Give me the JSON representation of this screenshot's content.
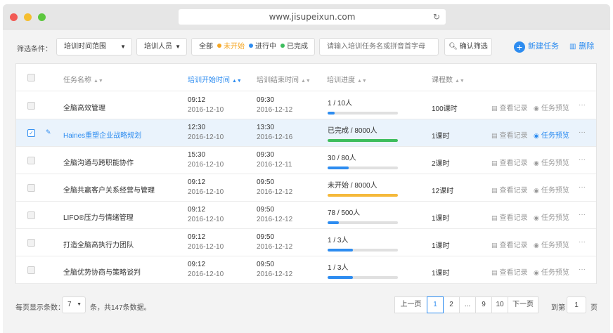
{
  "browser": {
    "url": "www.jisupeixun.com",
    "reload_icon": "reload-icon"
  },
  "filters": {
    "label": "筛选条件：",
    "time_range": "培训时间范围",
    "trainer": "培训人员",
    "status": {
      "all": "全部",
      "not_started": "未开始",
      "in_progress": "进行中",
      "done": "已完成"
    },
    "search_placeholder": "请输入培训任务名或拼音首字母",
    "confirm": "确认筛选",
    "new_task": "新建任务",
    "delete": "删除"
  },
  "colors": {
    "accent": "#2d8cf0",
    "not_started": "#f5a623",
    "in_progress": "#2d8cf0",
    "done": "#3dbd5d"
  },
  "table": {
    "headers": {
      "name": "任务名称",
      "start": "培训开始时间",
      "end": "培训结束时间",
      "progress": "培训进度",
      "courses": "课程数"
    },
    "action_view": "查看记录",
    "action_preview": "任务预览",
    "action_more": "···",
    "rows": [
      {
        "name": "全脑高效管理",
        "start_time": "09:12",
        "start_date": "2016-12-10",
        "end_time": "09:30",
        "end_date": "2016-12-12",
        "progress_text": "1 / 10人",
        "progress": 0.1,
        "bar_color": "#2d8cf0",
        "courses": "100课时",
        "selected": false
      },
      {
        "name": "Haines重塑企业战略规划",
        "start_time": "12:30",
        "start_date": "2016-12-10",
        "end_time": "13:30",
        "end_date": "2016-12-16",
        "progress_text": "已完成 / 8000人",
        "progress": 1.0,
        "bar_color": "#3dbd5d",
        "courses": "1课时",
        "selected": true
      },
      {
        "name": "全脑沟通与跨职能协作",
        "start_time": "15:30",
        "start_date": "2016-12-10",
        "end_time": "09:30",
        "end_date": "2016-12-11",
        "progress_text": "30 / 80人",
        "progress": 0.3,
        "bar_color": "#2d8cf0",
        "courses": "2课时",
        "selected": false
      },
      {
        "name": "全脑共赢客户关系经营与管理",
        "start_time": "09:12",
        "start_date": "2016-12-10",
        "end_time": "09:50",
        "end_date": "2016-12-12",
        "progress_text": "未开始 / 8000人",
        "progress": 1.0,
        "bar_color": "#f5b93b",
        "courses": "12课时",
        "selected": false
      },
      {
        "name": "LIFO®压力与情绪管理",
        "start_time": "09:12",
        "start_date": "2016-12-10",
        "end_time": "09:50",
        "end_date": "2016-12-12",
        "progress_text": "78 / 500人",
        "progress": 0.16,
        "bar_color": "#2d8cf0",
        "courses": "1课时",
        "selected": false
      },
      {
        "name": "打造全脑高执行力团队",
        "start_time": "09:12",
        "start_date": "2016-12-10",
        "end_time": "09:50",
        "end_date": "2016-12-12",
        "progress_text": "1 / 3人",
        "progress": 0.36,
        "bar_color": "#2d8cf0",
        "courses": "1课时",
        "selected": false
      },
      {
        "name": "全脑优势协商与策略谈判",
        "start_time": "09:12",
        "start_date": "2016-12-10",
        "end_time": "09:50",
        "end_date": "2016-12-12",
        "progress_text": "1 / 3人",
        "progress": 0.36,
        "bar_color": "#2d8cf0",
        "courses": "1课时",
        "selected": false
      }
    ]
  },
  "footer": {
    "per_page_label": "每页显示条数：",
    "per_page": "7",
    "total": "条，共147条数据。",
    "prev": "上一页",
    "pages": [
      "1",
      "2",
      "...",
      "9",
      "10"
    ],
    "current_page": "1",
    "next": "下一页",
    "goto_label": "到第",
    "goto_value": "1",
    "goto_suffix": "页"
  }
}
